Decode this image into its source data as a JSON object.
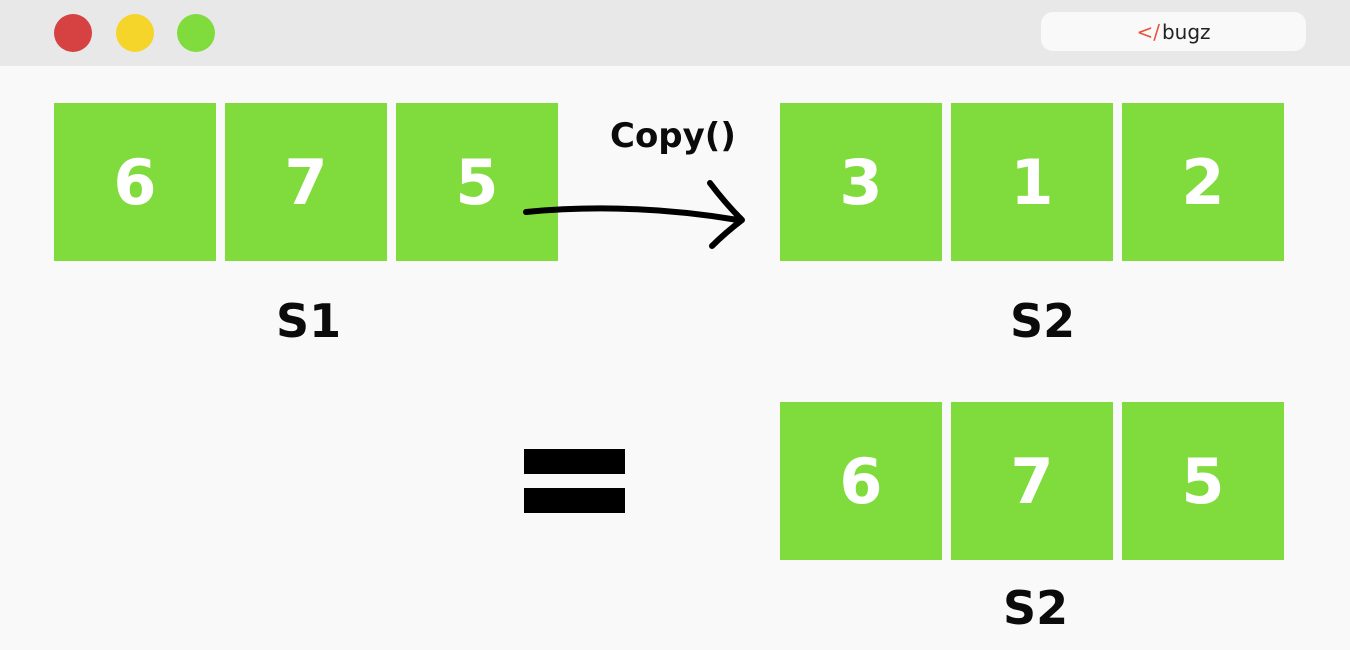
{
  "window": {
    "controls": [
      {
        "name": "close",
        "color": "#d64141"
      },
      {
        "name": "minimize",
        "color": "#f5d52a"
      },
      {
        "name": "zoom",
        "color": "#80dc3c"
      }
    ],
    "brand": {
      "tag": "</",
      "text": "bugz",
      "tag_color": "#e8533c"
    }
  },
  "diagram": {
    "operation": "Copy()",
    "cell_color": "#80dc3c",
    "source": {
      "label": "S1",
      "values": [
        "6",
        "7",
        "5"
      ]
    },
    "destination_before": {
      "label": "S2",
      "values": [
        "3",
        "1",
        "2"
      ]
    },
    "destination_after": {
      "label": "S2",
      "values": [
        "6",
        "7",
        "5"
      ]
    },
    "equals_icon": "equals-icon",
    "arrow_icon": "arrow-right-icon"
  }
}
